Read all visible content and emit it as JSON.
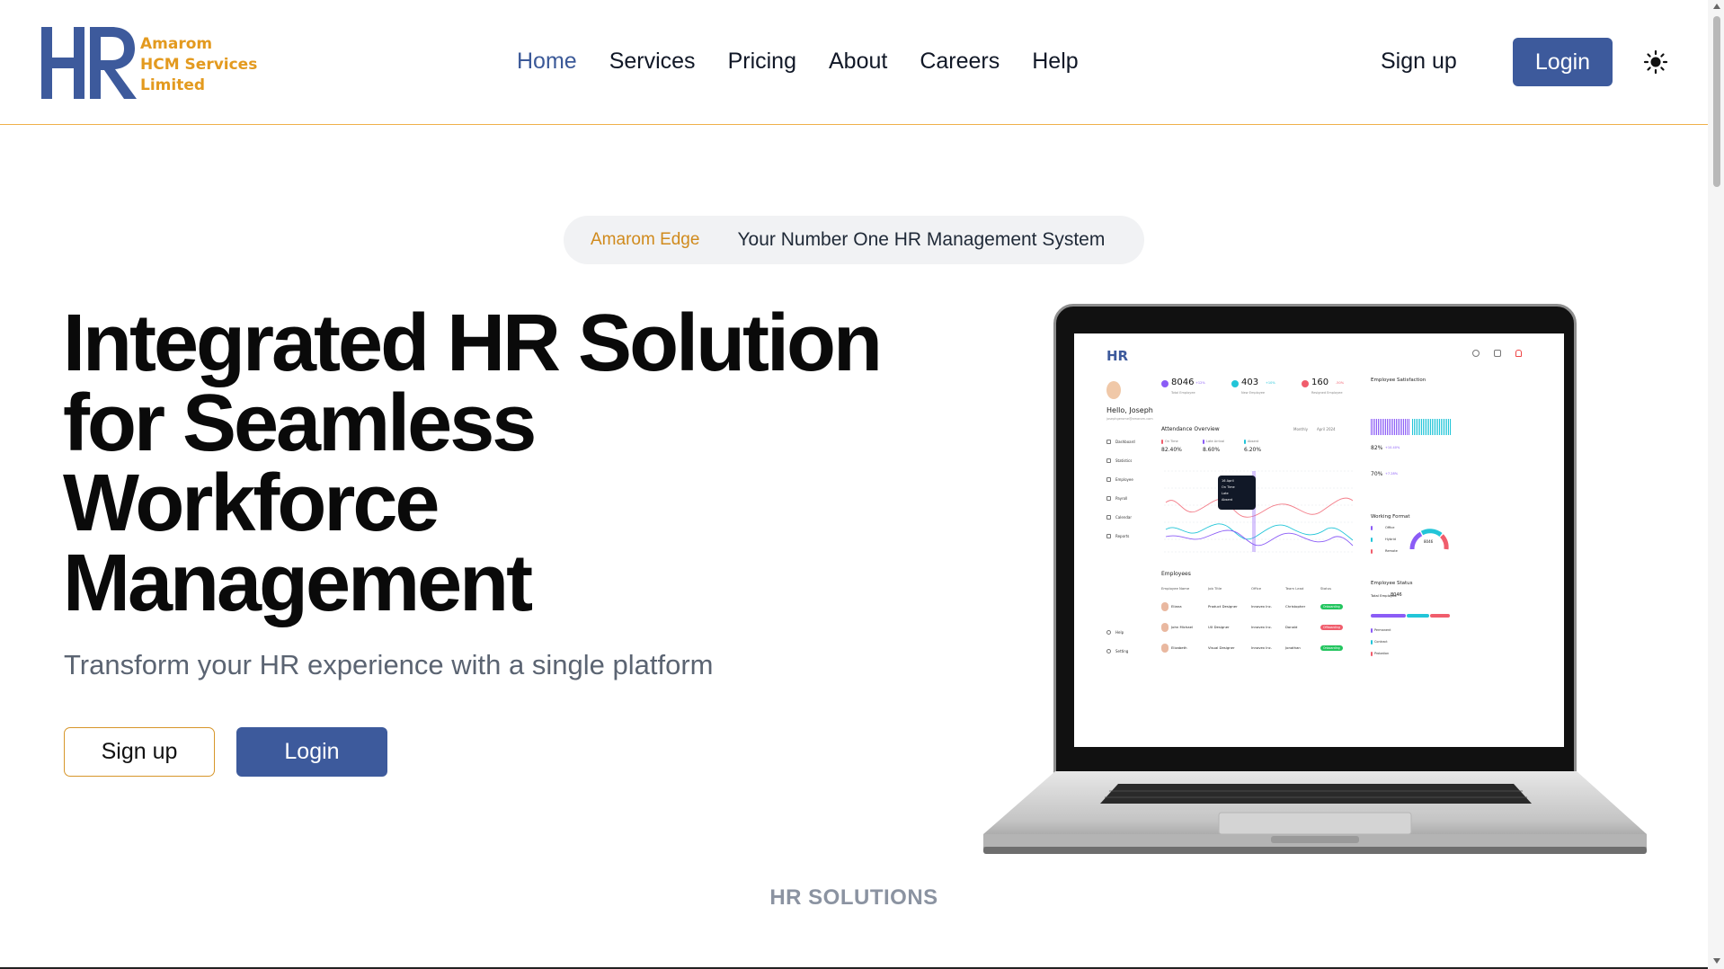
{
  "brand": {
    "logo_letters": "HR",
    "name_lines": [
      "Amarom",
      "HCM Services",
      "Limited"
    ]
  },
  "nav": {
    "items": [
      {
        "label": "Home",
        "active": true
      },
      {
        "label": "Services",
        "active": false
      },
      {
        "label": "Pricing",
        "active": false
      },
      {
        "label": "About",
        "active": false
      },
      {
        "label": "Careers",
        "active": false
      },
      {
        "label": "Help",
        "active": false
      }
    ],
    "signup_label": "Sign up",
    "login_label": "Login",
    "theme_icon": "sun-icon"
  },
  "hero": {
    "pill_brand": "Amarom Edge",
    "pill_text": "Your Number One HR Management System",
    "title_lines": [
      "Integrated HR Solution",
      "for Seamless",
      "Workforce",
      "Management"
    ],
    "subtitle": "Transform your HR experience with a single platform",
    "signup_label": "Sign up",
    "login_label": "Login"
  },
  "section_label": "HR SOLUTIONS",
  "dashboard_preview": {
    "greeting": "Hello, Joseph",
    "email": "josephgerome@amarom.com",
    "sidebar": [
      "Dashboard",
      "Statistics",
      "Employee",
      "Payroll",
      "Calendar",
      "Reports"
    ],
    "sidebar_bottom": [
      "Help",
      "Setting"
    ],
    "stats": [
      {
        "value": "8046",
        "delta": "+12%",
        "label": "Total Employee",
        "color": "#8b5cf6"
      },
      {
        "value": "403",
        "delta": "+10%",
        "label": "New Employee",
        "color": "#22c5d8"
      },
      {
        "value": "160",
        "delta": "-50%",
        "label": "Resigned Employee",
        "color": "#f05d6c"
      }
    ],
    "attendance_title": "Attendance Overview",
    "attendance_filters": [
      "Monthly",
      "April 2024"
    ],
    "attendance_stats": [
      {
        "label": "On Time",
        "value": "82.40%"
      },
      {
        "label": "Late Arrival",
        "value": "8.60%"
      },
      {
        "label": "Absent",
        "value": "6.20%"
      }
    ],
    "tooltip": [
      "16 April",
      "On Time",
      "Late",
      "Absent"
    ],
    "employees_title": "Employees",
    "employee_columns": [
      "Employee Name",
      "Job Title",
      "Office",
      "Team Lead",
      "Status"
    ],
    "employees": [
      {
        "name": "Eliana",
        "job": "Product Designer",
        "office": "Innovex Inc.",
        "lead": "Christopher",
        "status": "Onboarding"
      },
      {
        "name": "John Michael",
        "job": "UX Designer",
        "office": "Innovex Inc.",
        "lead": "Donald",
        "status": "Offboarding"
      },
      {
        "name": "Elizabeth",
        "job": "Visual Designer",
        "office": "Innovex Inc.",
        "lead": "Jonathan",
        "status": "Onboarding"
      }
    ],
    "satisfaction_title": "Employee Satisfaction",
    "satisfaction": [
      {
        "value": "82%",
        "delta": "+10.40%"
      },
      {
        "value": "70%",
        "delta": "+7.28%"
      }
    ],
    "working_format_title": "Working Format",
    "working_format": [
      "Office",
      "Hybrid",
      "Remote"
    ],
    "working_format_total": "8046",
    "status_title": "Employee Status",
    "status_total_label": "Total Employee",
    "status_total": "8046",
    "status_items": [
      "Permanent",
      "Contract",
      "Probation"
    ],
    "colors": {
      "purple": "#8b5cf6",
      "cyan": "#22c5d8",
      "red": "#f05d6c",
      "green": "#22c55e",
      "brand": "#3d5a9c"
    }
  },
  "colors": {
    "brand_blue": "#3d5a9c",
    "accent_orange": "#e39a1f",
    "header_border": "#f0b14a"
  }
}
